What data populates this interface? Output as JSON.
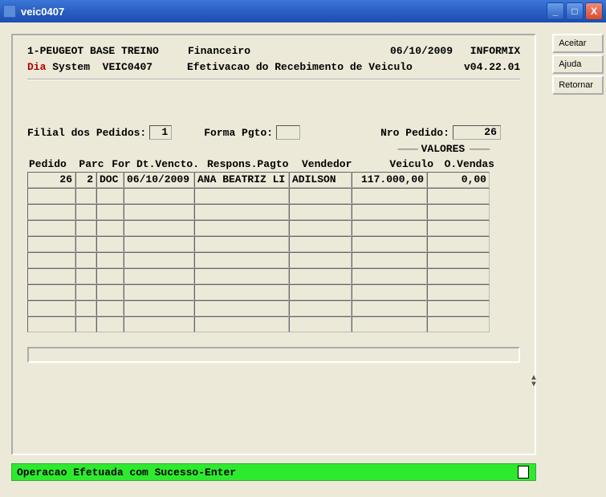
{
  "window": {
    "title": "veic0407"
  },
  "header": {
    "company": "1-PEUGEOT BASE TREINO",
    "module": "Financeiro",
    "date": "06/10/2009",
    "db": "INFORMIX",
    "dia": "Dia",
    "system": "System",
    "program": "VEIC0407",
    "description": "Efetivacao do Recebimento de Veiculo",
    "version": "v04.22.01"
  },
  "filters": {
    "filial_label": "Filial dos Pedidos:",
    "filial_value": "1",
    "forma_label": "Forma Pgto:",
    "forma_value": "",
    "nro_label": "Nro Pedido:",
    "nro_value": "26",
    "valores_label": "VALORES"
  },
  "columns": {
    "pedido": "Pedido",
    "parc": "Parc",
    "for": "For",
    "dt": "Dt.Vencto.",
    "resp": "Respons.Pagto",
    "vend": "Vendedor",
    "veic": "Veiculo",
    "ov": "O.Vendas"
  },
  "rows": [
    {
      "pedido": "26",
      "parc": "2",
      "for": "DOC",
      "dt": "06/10/2009",
      "resp": "ANA BEATRIZ LI",
      "vend": "ADILSON",
      "veic": "117.000,00",
      "ov": "0,00"
    },
    {
      "pedido": "",
      "parc": "",
      "for": "",
      "dt": "",
      "resp": "",
      "vend": "",
      "veic": "",
      "ov": ""
    },
    {
      "pedido": "",
      "parc": "",
      "for": "",
      "dt": "",
      "resp": "",
      "vend": "",
      "veic": "",
      "ov": ""
    },
    {
      "pedido": "",
      "parc": "",
      "for": "",
      "dt": "",
      "resp": "",
      "vend": "",
      "veic": "",
      "ov": ""
    },
    {
      "pedido": "",
      "parc": "",
      "for": "",
      "dt": "",
      "resp": "",
      "vend": "",
      "veic": "",
      "ov": ""
    },
    {
      "pedido": "",
      "parc": "",
      "for": "",
      "dt": "",
      "resp": "",
      "vend": "",
      "veic": "",
      "ov": ""
    },
    {
      "pedido": "",
      "parc": "",
      "for": "",
      "dt": "",
      "resp": "",
      "vend": "",
      "veic": "",
      "ov": ""
    },
    {
      "pedido": "",
      "parc": "",
      "for": "",
      "dt": "",
      "resp": "",
      "vend": "",
      "veic": "",
      "ov": ""
    },
    {
      "pedido": "",
      "parc": "",
      "for": "",
      "dt": "",
      "resp": "",
      "vend": "",
      "veic": "",
      "ov": ""
    },
    {
      "pedido": "",
      "parc": "",
      "for": "",
      "dt": "",
      "resp": "",
      "vend": "",
      "veic": "",
      "ov": ""
    }
  ],
  "status": {
    "message": "Operacao Efetuada com Sucesso-Enter"
  },
  "sidebar": {
    "aceitar": "Aceitar",
    "ajuda": "Ajuda",
    "retornar": "Retornar"
  }
}
